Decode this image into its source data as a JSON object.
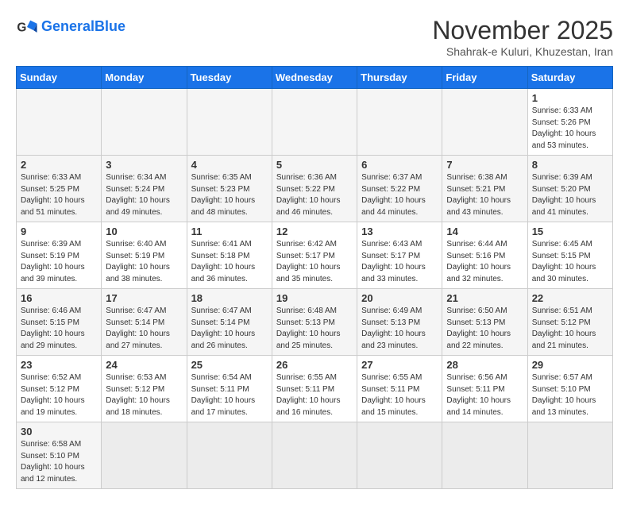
{
  "header": {
    "logo_general": "General",
    "logo_blue": "Blue",
    "month_title": "November 2025",
    "subtitle": "Shahrak-e Kuluri, Khuzestan, Iran"
  },
  "weekdays": [
    "Sunday",
    "Monday",
    "Tuesday",
    "Wednesday",
    "Thursday",
    "Friday",
    "Saturday"
  ],
  "weeks": [
    [
      {
        "day": "",
        "sunrise": "",
        "sunset": "",
        "daylight": ""
      },
      {
        "day": "",
        "sunrise": "",
        "sunset": "",
        "daylight": ""
      },
      {
        "day": "",
        "sunrise": "",
        "sunset": "",
        "daylight": ""
      },
      {
        "day": "",
        "sunrise": "",
        "sunset": "",
        "daylight": ""
      },
      {
        "day": "",
        "sunrise": "",
        "sunset": "",
        "daylight": ""
      },
      {
        "day": "",
        "sunrise": "",
        "sunset": "",
        "daylight": ""
      },
      {
        "day": "1",
        "sunrise": "Sunrise: 6:33 AM",
        "sunset": "Sunset: 5:26 PM",
        "daylight": "Daylight: 10 hours and 53 minutes."
      }
    ],
    [
      {
        "day": "2",
        "sunrise": "Sunrise: 6:33 AM",
        "sunset": "Sunset: 5:25 PM",
        "daylight": "Daylight: 10 hours and 51 minutes."
      },
      {
        "day": "3",
        "sunrise": "Sunrise: 6:34 AM",
        "sunset": "Sunset: 5:24 PM",
        "daylight": "Daylight: 10 hours and 49 minutes."
      },
      {
        "day": "4",
        "sunrise": "Sunrise: 6:35 AM",
        "sunset": "Sunset: 5:23 PM",
        "daylight": "Daylight: 10 hours and 48 minutes."
      },
      {
        "day": "5",
        "sunrise": "Sunrise: 6:36 AM",
        "sunset": "Sunset: 5:22 PM",
        "daylight": "Daylight: 10 hours and 46 minutes."
      },
      {
        "day": "6",
        "sunrise": "Sunrise: 6:37 AM",
        "sunset": "Sunset: 5:22 PM",
        "daylight": "Daylight: 10 hours and 44 minutes."
      },
      {
        "day": "7",
        "sunrise": "Sunrise: 6:38 AM",
        "sunset": "Sunset: 5:21 PM",
        "daylight": "Daylight: 10 hours and 43 minutes."
      },
      {
        "day": "8",
        "sunrise": "Sunrise: 6:39 AM",
        "sunset": "Sunset: 5:20 PM",
        "daylight": "Daylight: 10 hours and 41 minutes."
      }
    ],
    [
      {
        "day": "9",
        "sunrise": "Sunrise: 6:39 AM",
        "sunset": "Sunset: 5:19 PM",
        "daylight": "Daylight: 10 hours and 39 minutes."
      },
      {
        "day": "10",
        "sunrise": "Sunrise: 6:40 AM",
        "sunset": "Sunset: 5:19 PM",
        "daylight": "Daylight: 10 hours and 38 minutes."
      },
      {
        "day": "11",
        "sunrise": "Sunrise: 6:41 AM",
        "sunset": "Sunset: 5:18 PM",
        "daylight": "Daylight: 10 hours and 36 minutes."
      },
      {
        "day": "12",
        "sunrise": "Sunrise: 6:42 AM",
        "sunset": "Sunset: 5:17 PM",
        "daylight": "Daylight: 10 hours and 35 minutes."
      },
      {
        "day": "13",
        "sunrise": "Sunrise: 6:43 AM",
        "sunset": "Sunset: 5:17 PM",
        "daylight": "Daylight: 10 hours and 33 minutes."
      },
      {
        "day": "14",
        "sunrise": "Sunrise: 6:44 AM",
        "sunset": "Sunset: 5:16 PM",
        "daylight": "Daylight: 10 hours and 32 minutes."
      },
      {
        "day": "15",
        "sunrise": "Sunrise: 6:45 AM",
        "sunset": "Sunset: 5:15 PM",
        "daylight": "Daylight: 10 hours and 30 minutes."
      }
    ],
    [
      {
        "day": "16",
        "sunrise": "Sunrise: 6:46 AM",
        "sunset": "Sunset: 5:15 PM",
        "daylight": "Daylight: 10 hours and 29 minutes."
      },
      {
        "day": "17",
        "sunrise": "Sunrise: 6:47 AM",
        "sunset": "Sunset: 5:14 PM",
        "daylight": "Daylight: 10 hours and 27 minutes."
      },
      {
        "day": "18",
        "sunrise": "Sunrise: 6:47 AM",
        "sunset": "Sunset: 5:14 PM",
        "daylight": "Daylight: 10 hours and 26 minutes."
      },
      {
        "day": "19",
        "sunrise": "Sunrise: 6:48 AM",
        "sunset": "Sunset: 5:13 PM",
        "daylight": "Daylight: 10 hours and 25 minutes."
      },
      {
        "day": "20",
        "sunrise": "Sunrise: 6:49 AM",
        "sunset": "Sunset: 5:13 PM",
        "daylight": "Daylight: 10 hours and 23 minutes."
      },
      {
        "day": "21",
        "sunrise": "Sunrise: 6:50 AM",
        "sunset": "Sunset: 5:13 PM",
        "daylight": "Daylight: 10 hours and 22 minutes."
      },
      {
        "day": "22",
        "sunrise": "Sunrise: 6:51 AM",
        "sunset": "Sunset: 5:12 PM",
        "daylight": "Daylight: 10 hours and 21 minutes."
      }
    ],
    [
      {
        "day": "23",
        "sunrise": "Sunrise: 6:52 AM",
        "sunset": "Sunset: 5:12 PM",
        "daylight": "Daylight: 10 hours and 19 minutes."
      },
      {
        "day": "24",
        "sunrise": "Sunrise: 6:53 AM",
        "sunset": "Sunset: 5:12 PM",
        "daylight": "Daylight: 10 hours and 18 minutes."
      },
      {
        "day": "25",
        "sunrise": "Sunrise: 6:54 AM",
        "sunset": "Sunset: 5:11 PM",
        "daylight": "Daylight: 10 hours and 17 minutes."
      },
      {
        "day": "26",
        "sunrise": "Sunrise: 6:55 AM",
        "sunset": "Sunset: 5:11 PM",
        "daylight": "Daylight: 10 hours and 16 minutes."
      },
      {
        "day": "27",
        "sunrise": "Sunrise: 6:55 AM",
        "sunset": "Sunset: 5:11 PM",
        "daylight": "Daylight: 10 hours and 15 minutes."
      },
      {
        "day": "28",
        "sunrise": "Sunrise: 6:56 AM",
        "sunset": "Sunset: 5:11 PM",
        "daylight": "Daylight: 10 hours and 14 minutes."
      },
      {
        "day": "29",
        "sunrise": "Sunrise: 6:57 AM",
        "sunset": "Sunset: 5:10 PM",
        "daylight": "Daylight: 10 hours and 13 minutes."
      }
    ],
    [
      {
        "day": "30",
        "sunrise": "Sunrise: 6:58 AM",
        "sunset": "Sunset: 5:10 PM",
        "daylight": "Daylight: 10 hours and 12 minutes."
      },
      {
        "day": "",
        "sunrise": "",
        "sunset": "",
        "daylight": ""
      },
      {
        "day": "",
        "sunrise": "",
        "sunset": "",
        "daylight": ""
      },
      {
        "day": "",
        "sunrise": "",
        "sunset": "",
        "daylight": ""
      },
      {
        "day": "",
        "sunrise": "",
        "sunset": "",
        "daylight": ""
      },
      {
        "day": "",
        "sunrise": "",
        "sunset": "",
        "daylight": ""
      },
      {
        "day": "",
        "sunrise": "",
        "sunset": "",
        "daylight": ""
      }
    ]
  ]
}
